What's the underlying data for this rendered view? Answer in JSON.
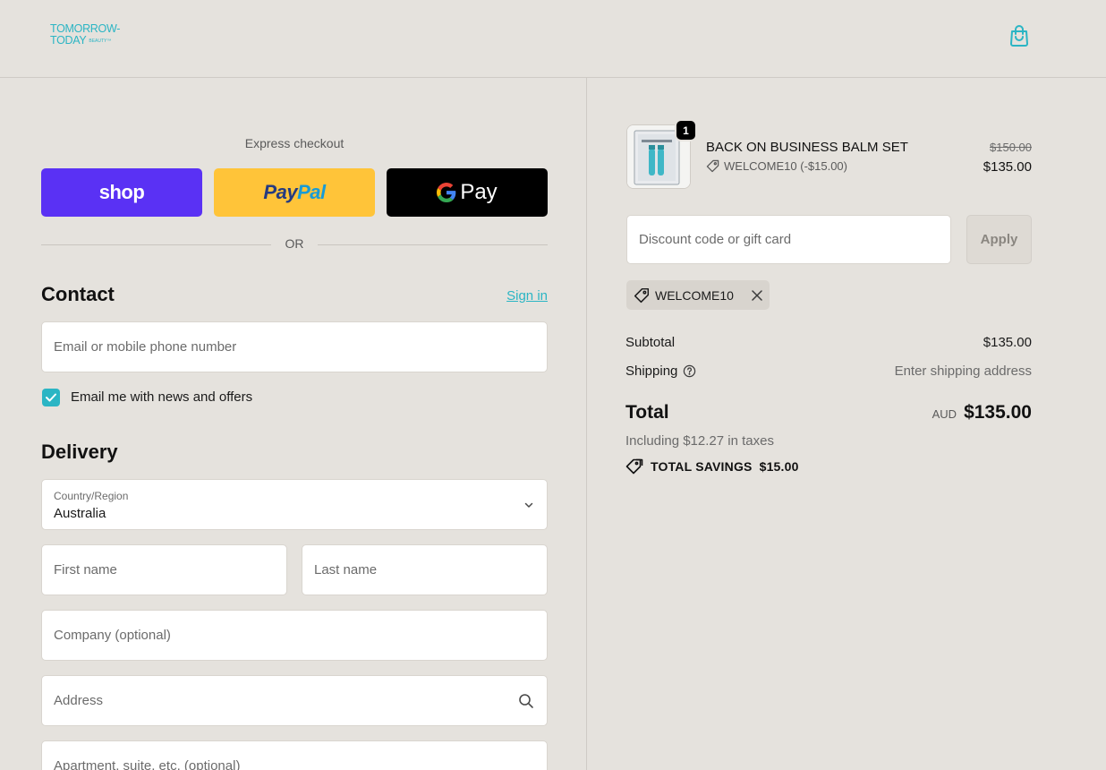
{
  "header": {
    "logo_line1": "TOMORROW-",
    "logo_line2": "TODAY",
    "logo_sub": "BEAUTY™",
    "bag_icon": "shopping-bag-icon"
  },
  "express": {
    "label": "Express checkout",
    "shop_label": "shop",
    "paypal_pay": "Pay",
    "paypal_pal": "Pal",
    "gpay_label": "Pay",
    "or_label": "OR"
  },
  "contact": {
    "title": "Contact",
    "sign_in": "Sign in",
    "email_placeholder": "Email or mobile phone number",
    "email_value": "",
    "newsletter_label": "Email me with news and offers",
    "newsletter_checked": true
  },
  "delivery": {
    "title": "Delivery",
    "country_label": "Country/Region",
    "country_value": "Australia",
    "first_name_placeholder": "First name",
    "last_name_placeholder": "Last name",
    "company_placeholder": "Company (optional)",
    "address_placeholder": "Address",
    "apartment_placeholder": "Apartment, suite, etc. (optional)"
  },
  "order": {
    "item": {
      "quantity": "1",
      "name": "BACK ON BUSINESS BALM SET",
      "discount": "WELCOME10 (-$15.00)",
      "original_price": "$150.00",
      "price": "$135.00"
    },
    "discount_placeholder": "Discount code or gift card",
    "apply_label": "Apply",
    "applied_code": "WELCOME10",
    "subtotal_label": "Subtotal",
    "subtotal_value": "$135.00",
    "shipping_label": "Shipping",
    "shipping_value": "Enter shipping address",
    "total_label": "Total",
    "currency": "AUD",
    "total_value": "$135.00",
    "taxes": "Including $12.27 in taxes",
    "savings_label": "TOTAL SAVINGS",
    "savings_value": "$15.00"
  },
  "colors": {
    "background": "#e5e2dd",
    "accent": "#2bb5c4",
    "shop_purple": "#5a31f4",
    "paypal_yellow": "#ffc439"
  }
}
